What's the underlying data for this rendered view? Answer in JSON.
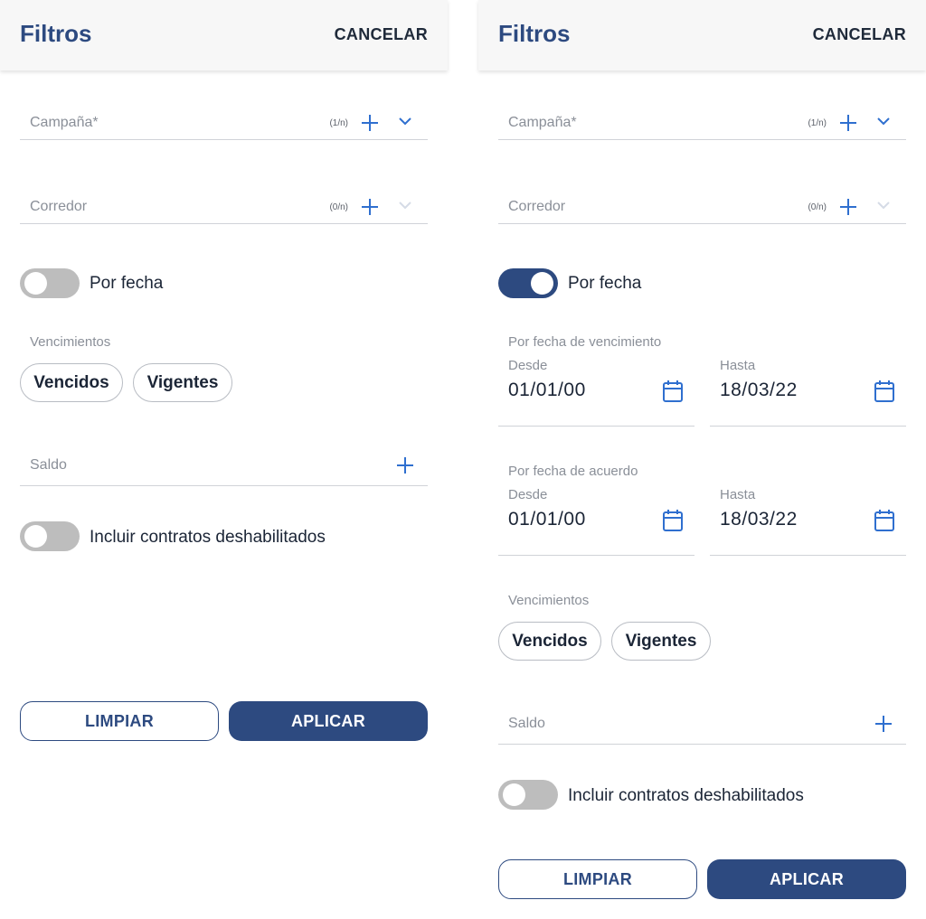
{
  "left": {
    "header": {
      "title": "Filtros",
      "cancel_label": "CANCELAR"
    },
    "campana": {
      "label": "Campaña*",
      "count": "(1/n)"
    },
    "corredor": {
      "label": "Corredor",
      "count": "(0/n)"
    },
    "por_fecha": {
      "label": "Por fecha",
      "enabled": false
    },
    "vencimientos": {
      "label": "Vencimientos",
      "chips": [
        "Vencidos",
        "Vigentes"
      ]
    },
    "saldo": {
      "label": "Saldo"
    },
    "incluir": {
      "label": "Incluir contratos deshabilitados",
      "enabled": false
    },
    "buttons": {
      "clear": "LIMPIAR",
      "apply": "APLICAR"
    }
  },
  "right": {
    "header": {
      "title": "Filtros",
      "cancel_label": "CANCELAR"
    },
    "campana": {
      "label": "Campaña*",
      "count": "(1/n)"
    },
    "corredor": {
      "label": "Corredor",
      "count": "(0/n)"
    },
    "por_fecha": {
      "label": "Por fecha",
      "enabled": true
    },
    "vencimiento_range": {
      "label": "Por fecha de vencimiento",
      "from_label": "Desde",
      "from_value": "01/01/00",
      "to_label": "Hasta",
      "to_value": "18/03/22"
    },
    "acuerdo_range": {
      "label": "Por fecha de acuerdo",
      "from_label": "Desde",
      "from_value": "01/01/00",
      "to_label": "Hasta",
      "to_value": "18/03/22"
    },
    "vencimientos": {
      "label": "Vencimientos",
      "chips": [
        "Vencidos",
        "Vigentes"
      ]
    },
    "saldo": {
      "label": "Saldo"
    },
    "incluir": {
      "label": "Incluir contratos deshabilitados",
      "enabled": false
    },
    "buttons": {
      "clear": "LIMPIAR",
      "apply": "APLICAR"
    }
  },
  "colors": {
    "primary": "#2d4a80",
    "accent_blue": "#2f6fcf",
    "toggle_off": "#bdbdbd",
    "muted_text": "#8a8f98",
    "divider": "#d0d3d8"
  },
  "icons": [
    "plus-icon",
    "chevron-down-icon",
    "calendar-icon"
  ]
}
